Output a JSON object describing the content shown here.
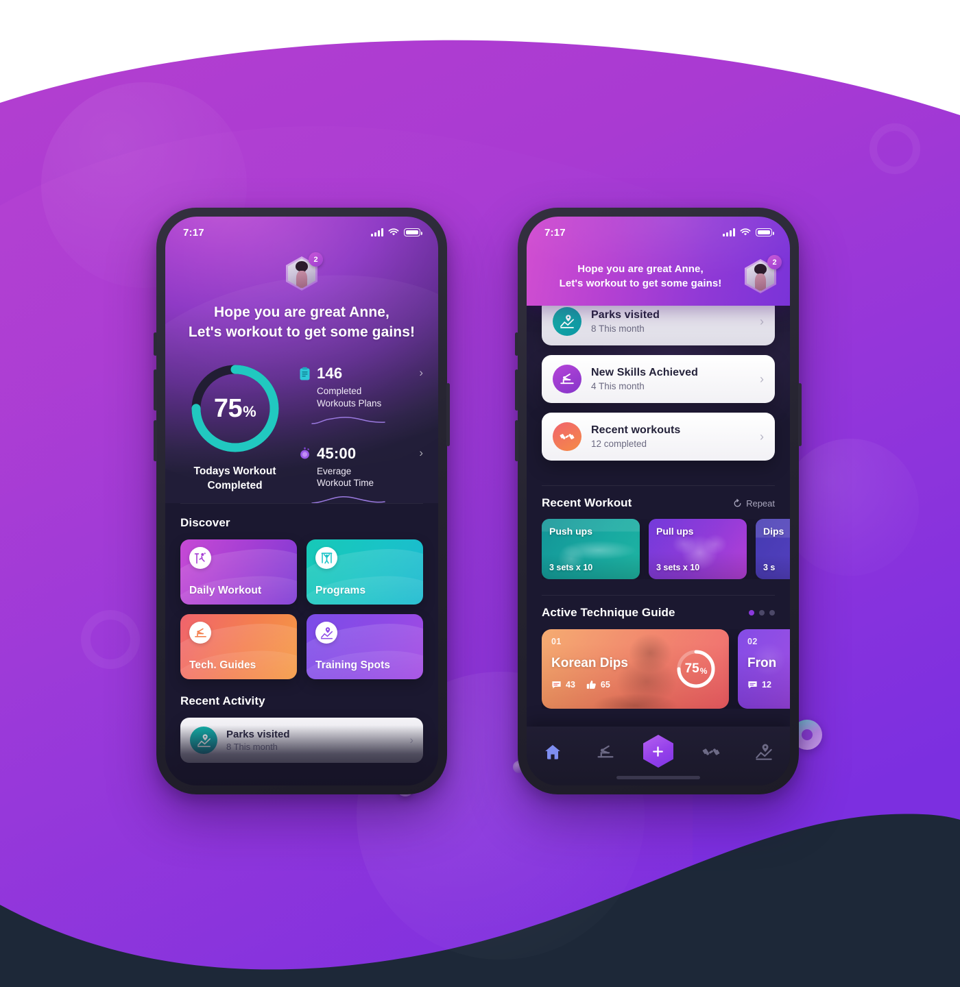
{
  "meta": {
    "accent_purple": "#8b39dd",
    "accent_teal": "#21c8c0",
    "accent_orange": "#f4804f",
    "bg_dark": "#1b1830",
    "bg_navy": "#1d2838"
  },
  "status_bar": {
    "time": "7:17",
    "signal_icon": "cellular-signal-icon",
    "wifi_icon": "wifi-icon",
    "battery_icon": "battery-full-icon"
  },
  "left_screen": {
    "avatar": {
      "icon": "user-avatar",
      "badge_count": "2"
    },
    "greeting_line1": "Hope you are great Anne,",
    "greeting_line2": "Let's workout to get some gains!",
    "donut": {
      "value": "75",
      "unit": "%",
      "percent": 75,
      "caption_line1": "Todays Workout",
      "caption_line2": "Completed",
      "track_color": "#1f1c2e",
      "progress_color": "#21c8c0"
    },
    "metrics": [
      {
        "icon": "clipboard-icon",
        "icon_color": "#2ec8d8",
        "value": "146",
        "label_line1": "Completed",
        "label_line2": "Workouts Plans",
        "chevron": "chevron-right-icon",
        "sparkline": [
          6,
          9,
          7,
          12,
          14,
          13,
          10,
          11,
          9
        ]
      },
      {
        "icon": "stopwatch-icon",
        "icon_color": "#9b5bea",
        "value": "45:00",
        "label_line1": "Everage",
        "label_line2": "Workout Time",
        "chevron": "chevron-right-icon",
        "sparkline": [
          7,
          8,
          11,
          14,
          12,
          10,
          11,
          9,
          8
        ]
      }
    ],
    "discover": {
      "title": "Discover",
      "tiles": [
        {
          "label": "Daily Workout",
          "icon": "person-jumping-icon",
          "theme": "t-daily"
        },
        {
          "label": "Programs",
          "icon": "pullup-bar-icon",
          "theme": "t-programs"
        },
        {
          "label": "Tech. Guides",
          "icon": "gymnast-icon",
          "theme": "t-tech"
        },
        {
          "label": "Training Spots",
          "icon": "map-pin-icon",
          "theme": "t-spots"
        }
      ]
    },
    "recent_activity": {
      "title": "Recent Activity",
      "items": [
        {
          "title": "Parks visited",
          "subtitle": "8 This month",
          "icon": "map-pin-icon",
          "chevron": "chevron-right-icon"
        }
      ]
    }
  },
  "right_screen": {
    "header": {
      "greeting_line1": "Hope you are great Anne,",
      "greeting_line2": "Let's workout to get some gains!",
      "avatar": {
        "icon": "user-avatar",
        "badge_count": "2"
      }
    },
    "cards": [
      {
        "title": "Parks visited",
        "subtitle": "8 This month",
        "icon": "map-pin-icon",
        "icon_theme": "teal",
        "chevron": "chevron-right-icon",
        "partial": true
      },
      {
        "title": "New Skills Achieved",
        "subtitle": "4 This month",
        "icon": "gymnast-icon",
        "icon_theme": "violet",
        "chevron": "chevron-right-icon",
        "partial": false
      },
      {
        "title": "Recent workouts",
        "subtitle": "12 completed",
        "icon": "dumbbell-icon",
        "icon_theme": "orange",
        "chevron": "chevron-right-icon",
        "partial": false
      }
    ],
    "recent_workout": {
      "title": "Recent Workout",
      "repeat_label": "Repeat",
      "repeat_icon": "repeat-icon",
      "items": [
        {
          "name": "Push ups",
          "sets": "3 sets x 10",
          "theme": "wk-1"
        },
        {
          "name": "Pull ups",
          "sets": "3 sets x 10",
          "theme": "wk-2"
        },
        {
          "name": "Dips",
          "sets": "3 s",
          "theme": "wk-3"
        }
      ]
    },
    "technique_guide": {
      "title": "Active Technique Guide",
      "dots": 3,
      "active_dot": 0,
      "items": [
        {
          "number": "01",
          "title": "Korean Dips",
          "progress": "75",
          "progress_unit": "%",
          "percent": 75,
          "comments": "43",
          "comments_icon": "comment-icon",
          "likes": "65",
          "likes_icon": "thumbs-up-icon",
          "theme": "g-1"
        },
        {
          "number": "02",
          "title": "Fron",
          "comments": "12",
          "comments_icon": "comment-icon",
          "theme": "g-2"
        }
      ]
    },
    "tabbar": {
      "items": [
        {
          "icon": "home-icon",
          "label": "Home",
          "active": true
        },
        {
          "icon": "gymnast-icon",
          "label": "Guides",
          "active": false
        },
        {
          "icon": "plus-icon",
          "label": "Add",
          "active": false,
          "fab": true
        },
        {
          "icon": "dumbbell-icon",
          "label": "Workouts",
          "active": false
        },
        {
          "icon": "map-pin-icon",
          "label": "Spots",
          "active": false
        }
      ]
    }
  }
}
